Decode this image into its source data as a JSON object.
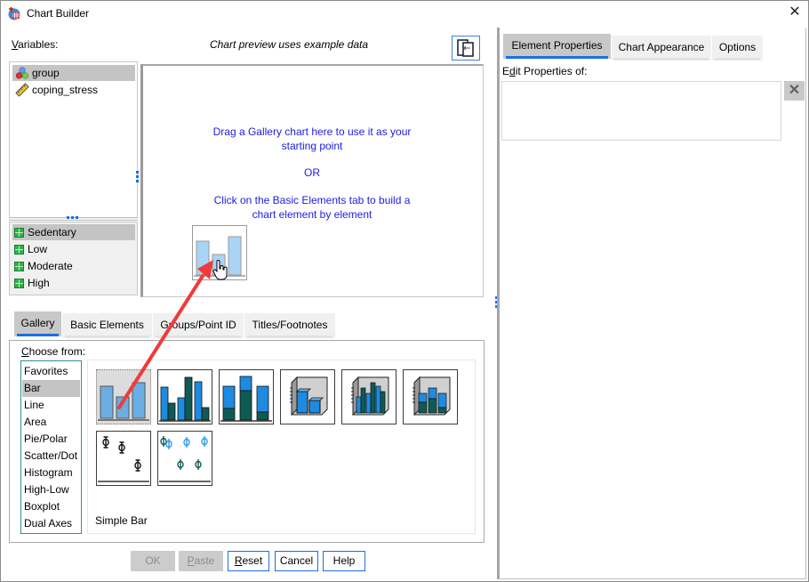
{
  "window": {
    "title": "Chart Builder",
    "close_icon": "close-icon"
  },
  "variables": {
    "label": "Variables:",
    "label_mnemonic": "V",
    "label_rest": "ariables:",
    "items": [
      {
        "name": "group",
        "icon": "nominal-variable-icon",
        "selected": true
      },
      {
        "name": "coping_stress",
        "icon": "scale-variable-icon",
        "selected": false
      }
    ]
  },
  "categories": {
    "items": [
      {
        "name": "Sedentary",
        "selected": true
      },
      {
        "name": "Low",
        "selected": false
      },
      {
        "name": "Moderate",
        "selected": false
      },
      {
        "name": "High",
        "selected": false
      }
    ]
  },
  "preview": {
    "note": "Chart preview uses example data",
    "toggle_icon": "panel-toggle-icon",
    "message_line1": "Drag a Gallery chart here to use it as your",
    "message_line2": "starting point",
    "message_or": "OR",
    "message_line3": "Click on the Basic Elements tab to build a",
    "message_line4": "chart element by element"
  },
  "gallery_tabs": [
    {
      "label": "Gallery",
      "active": true
    },
    {
      "label": "Basic Elements",
      "active": false
    },
    {
      "label": "Groups/Point ID",
      "active": false
    },
    {
      "label": "Titles/Footnotes",
      "active": false
    }
  ],
  "gallery": {
    "choose_label_mnemonic": "C",
    "choose_label_rest": "hoose from:",
    "types": [
      "Favorites",
      "Bar",
      "Line",
      "Area",
      "Pie/Polar",
      "Scatter/Dot",
      "Histogram",
      "High-Low",
      "Boxplot",
      "Dual Axes"
    ],
    "selected_type": "Bar",
    "thumbnails": [
      {
        "name": "Simple Bar",
        "selected": true
      },
      {
        "name": "Clustered Bar",
        "selected": false
      },
      {
        "name": "Stacked Bar",
        "selected": false
      },
      {
        "name": "Simple 3-D Bar",
        "selected": false
      },
      {
        "name": "Clustered 3-D Bar",
        "selected": false
      },
      {
        "name": "Stacked 3-D Bar",
        "selected": false
      },
      {
        "name": "Simple Error Bar",
        "selected": false
      },
      {
        "name": "Clustered Error Bar",
        "selected": false
      }
    ],
    "selected_description": "Simple Bar"
  },
  "buttons": {
    "ok": {
      "label": "OK",
      "enabled": false
    },
    "paste": {
      "label": "Paste",
      "mnemonic": "P",
      "rest": "aste",
      "enabled": false
    },
    "reset": {
      "label": "Reset",
      "mnemonic": "R",
      "rest": "eset",
      "enabled": true
    },
    "cancel": {
      "label": "Cancel",
      "enabled": true
    },
    "help": {
      "label": "Help",
      "enabled": true
    }
  },
  "properties_tabs": [
    {
      "label": "Element Properties",
      "active": true
    },
    {
      "label": "Chart Appearance",
      "active": false
    },
    {
      "label": "Options",
      "active": false
    }
  ],
  "properties": {
    "edit_label_pre": "E",
    "edit_label_mnemonic": "d",
    "edit_label_rest": "it Properties of:",
    "delete_icon": "delete-icon"
  },
  "colors": {
    "accent": "#1a6ee8",
    "message_text": "#1c1ce0",
    "bar_light": "#a9d4f5",
    "bar_blue": "#1e8be0",
    "bar_dark": "#0f5a55",
    "arrow_red": "#ee3b3b"
  }
}
